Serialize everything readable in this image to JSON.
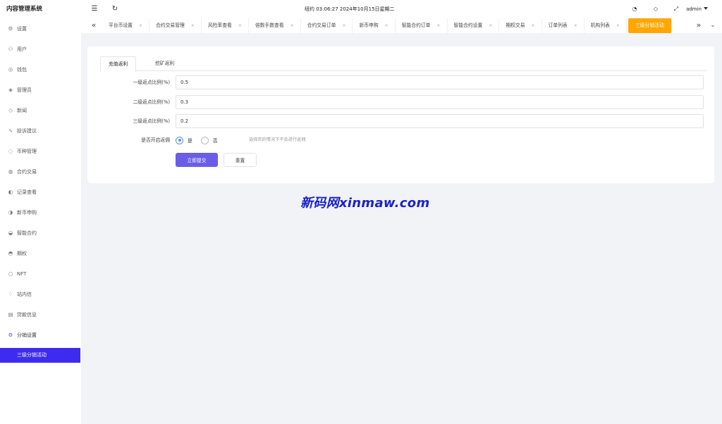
{
  "app": {
    "title": "内容管理系统"
  },
  "sidebar": {
    "items": [
      {
        "label": "设置",
        "icon": "gear-icon",
        "glyph": "⚙"
      },
      {
        "label": "用户",
        "icon": "user-icon",
        "glyph": "⚇"
      },
      {
        "label": "钱包",
        "icon": "wallet-icon",
        "glyph": "◎"
      },
      {
        "label": "管理员",
        "icon": "shield-icon",
        "glyph": "◈"
      },
      {
        "label": "新闻",
        "icon": "tag-icon",
        "glyph": "◇"
      },
      {
        "label": "投诉建议",
        "icon": "chart-line-icon",
        "glyph": "∿"
      },
      {
        "label": "币种管理",
        "icon": "coin-icon",
        "glyph": "◌"
      },
      {
        "label": "合约交易",
        "icon": "compass-icon",
        "glyph": "◍"
      },
      {
        "label": "记录查看",
        "icon": "record-icon",
        "glyph": "◐"
      },
      {
        "label": "新币申购",
        "icon": "coin-add-icon",
        "glyph": "◑"
      },
      {
        "label": "智能合约",
        "icon": "contract-icon",
        "glyph": "◒"
      },
      {
        "label": "期权",
        "icon": "option-icon",
        "glyph": "◓"
      },
      {
        "label": "NFT",
        "icon": "nft-icon",
        "glyph": "○"
      },
      {
        "label": "站内信",
        "icon": "bell-icon",
        "glyph": "♢"
      },
      {
        "label": "贷款信息",
        "icon": "loan-icon",
        "glyph": "▤"
      },
      {
        "label": "分销设置",
        "icon": "settings-active-icon",
        "glyph": "⚙"
      }
    ],
    "submenu_active": "三级分销活动"
  },
  "header": {
    "clock": "纽约 03:06:27 2024年10月15日星期二",
    "user": "admin"
  },
  "tabs": {
    "items": [
      "平台币设置",
      "合约交易管理",
      "风险率查看",
      "倍数手数查看",
      "合约交易订单",
      "新币申购",
      "智能合约订单",
      "智能合约设置",
      "期权交易",
      "订单列表",
      "机构列表"
    ],
    "close_glyph": "×",
    "active": "三级分销活动"
  },
  "form": {
    "subtabs": {
      "recharge": "充值返利",
      "mining": "挖矿返利"
    },
    "level1": {
      "label": "一级返点比例(%)",
      "value": "0.5"
    },
    "level2": {
      "label": "二级返点比例(%)",
      "value": "0.3"
    },
    "level3": {
      "label": "三级返点比例(%)",
      "value": "0.2"
    },
    "rebate": {
      "label": "是否开启返佣",
      "yes": "是",
      "no": "否",
      "selected": "是",
      "hint": "选择否的情况下不会进行返佣"
    },
    "submit": "立即提交",
    "reset": "重置"
  },
  "watermark": "新码网xinmaw.com",
  "colors": {
    "accent": "#6a5de8",
    "active_submenu": "#3d2cf0",
    "active_tab": "#ffa700",
    "radio": "#5b8dd8",
    "watermark": "#1a22c8"
  }
}
